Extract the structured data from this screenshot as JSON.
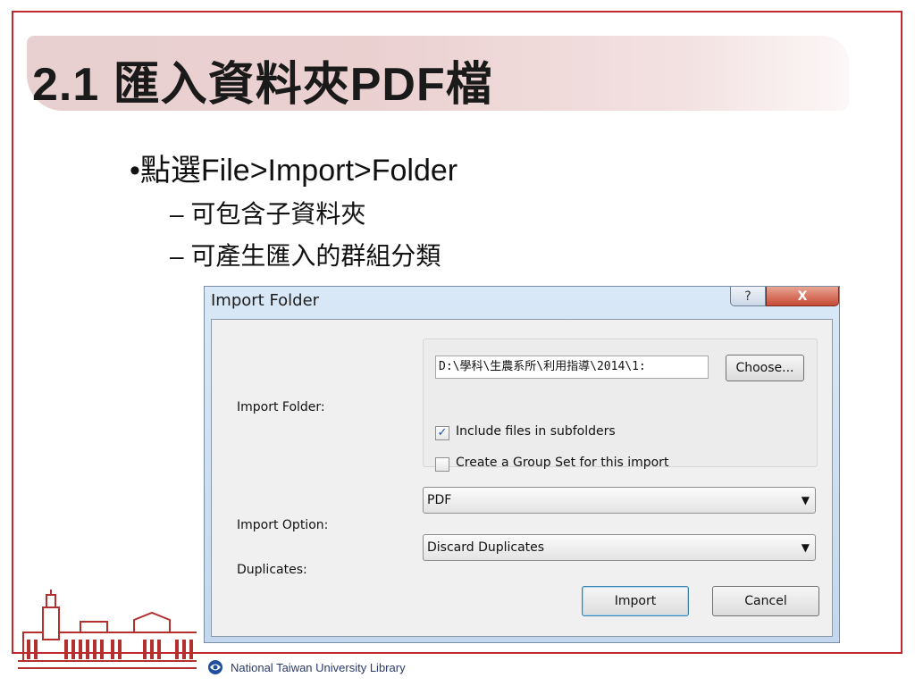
{
  "slide": {
    "title": "2.1 匯入資料夾PDF檔",
    "bullet": "•點選File>Import>Folder",
    "sub_items": [
      "– 可包含子資料夾",
      "– 可產生匯入的群組分類"
    ],
    "footer": "National Taiwan University Library",
    "accent_color": "#c0282d"
  },
  "dialog": {
    "title": "Import Folder",
    "help_label": "?",
    "close_label": "X",
    "import_folder_label": "Import Folder:",
    "folder_path": "D:\\學科\\生農系所\\利用指導\\2014\\1:",
    "choose_label": "Choose...",
    "include_subfolders_label": "Include files in subfolders",
    "include_subfolders_checked": true,
    "create_group_set_label": "Create a Group Set for this import",
    "create_group_set_checked": false,
    "import_option_label": "Import Option:",
    "import_option_value": "PDF",
    "duplicates_label": "Duplicates:",
    "duplicates_value": "Discard Duplicates",
    "import_button": "Import",
    "cancel_button": "Cancel"
  },
  "icons": {
    "logo": "ntu-library-building-logo",
    "footer_logo": "ntu-library-swirl-icon",
    "dropdown": "chevron-down-icon",
    "checkmark": "checkmark-icon"
  }
}
